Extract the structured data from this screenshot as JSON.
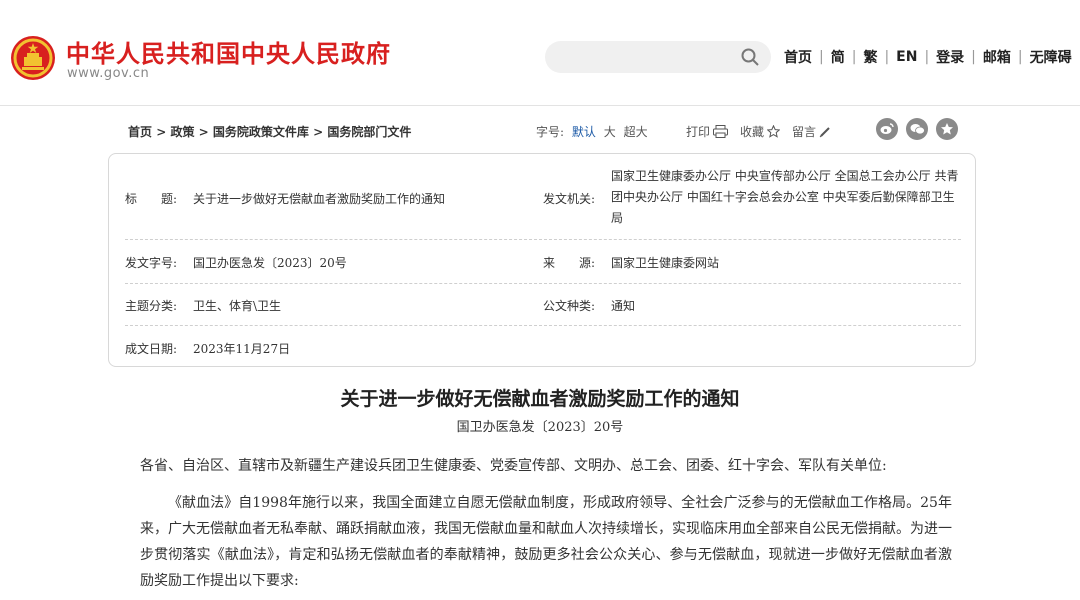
{
  "header": {
    "site_title": "中华人民共和国中央人民政府",
    "site_url": "www.gov.cn",
    "search_placeholder": "",
    "nav": [
      "首页",
      "简",
      "繁",
      "EN",
      "登录",
      "邮箱",
      "无障碍"
    ],
    "nav_separator": "|"
  },
  "subbar": {
    "breadcrumb": [
      "首页",
      "政策",
      "国务院政策文件库",
      "国务院部门文件"
    ],
    "breadcrumb_separator": ">",
    "font_size_label": "字号:",
    "font_size_options": [
      "默认",
      "大",
      "超大"
    ],
    "print_label": "打印",
    "favorite_label": "收藏",
    "comment_label": "留言"
  },
  "info": {
    "title_label": "标　　题:",
    "title_value": "关于进一步做好无偿献血者激励奖励工作的通知",
    "issuer_label": "发文机关:",
    "issuer_value": "国家卫生健康委办公厅 中央宣传部办公厅 全国总工会办公厅 共青团中央办公厅 中国红十字会总会办公室 中央军委后勤保障部卫生局",
    "doc_no_label": "发文字号:",
    "doc_no_value": "国卫办医急发〔2023〕20号",
    "source_label": "来　　源:",
    "source_value": "国家卫生健康委网站",
    "topic_label": "主题分类:",
    "topic_value": "卫生、体育\\卫生",
    "type_label": "公文种类:",
    "type_value": "通知",
    "date_label": "成文日期:",
    "date_value": "2023年11月27日"
  },
  "document": {
    "title": "关于进一步做好无偿献血者激励奖励工作的通知",
    "number": "国卫办医急发〔2023〕20号",
    "salutation": "各省、自治区、直辖市及新疆生产建设兵团卫生健康委、党委宣传部、文明办、总工会、团委、红十字会、军队有关单位:",
    "paragraph_1": "《献血法》自1998年施行以来，我国全面建立自愿无偿献血制度，形成政府领导、全社会广泛参与的无偿献血工作格局。25年来，广大无偿献血者无私奉献、踊跃捐献血液，我国无偿献血量和献血人次持续增长，实现临床用血全部来自公民无偿捐献。为进一步贯彻落实《献血法》，肯定和弘扬无偿献血者的奉献精神，鼓励更多社会公众关心、参与无偿献血，现就进一步做好无偿献血者激励奖励工作提出以下要求:"
  },
  "colors": {
    "brand_red": "#d8201f",
    "link_blue": "#1c5aa6",
    "emblem_gold": "#f2c230"
  }
}
